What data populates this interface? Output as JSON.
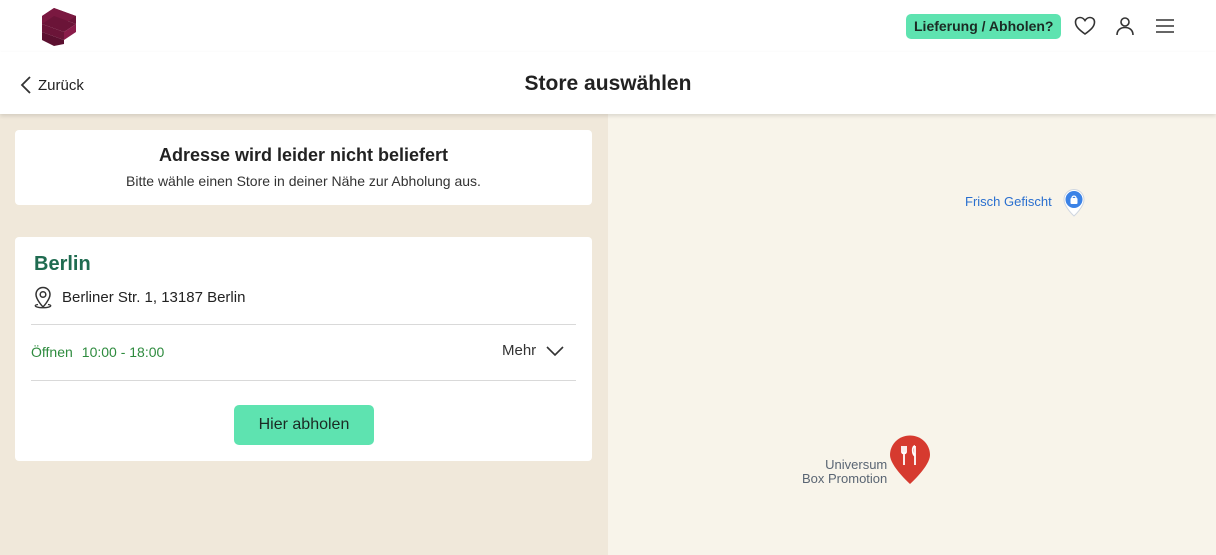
{
  "header": {
    "delivery_label": "Lieferung / Abholen?",
    "logo_icon": "brand-logo-icon",
    "icons": [
      "heart-icon",
      "user-icon",
      "menu-icon"
    ]
  },
  "subheader": {
    "back_label": "Zurück",
    "title": "Store auswählen"
  },
  "notice": {
    "title": "Adresse wird leider nicht beliefert",
    "text": "Bitte wähle einen Store in deiner Nähe zur Abholung aus."
  },
  "store": {
    "name": "Berlin",
    "address": "Berliner Str. 1, 13187 Berlin",
    "open_label": "Öffnen",
    "hours": "10:00 - 18:00",
    "more_label": "Mehr",
    "pickup_label": "Hier abholen"
  },
  "map": {
    "poi1": {
      "label": "Frisch Gefischt",
      "icon": "shopping-bag-pin-icon"
    },
    "poi2": {
      "line1": "Universum",
      "line2": "Box Promotion",
      "icon": "restaurant-pin-icon"
    }
  },
  "colors": {
    "accent": "#5ee3b0",
    "brand": "#6b1438",
    "store_name": "#1f6b50",
    "open_text": "#2e8b3e",
    "left_bg": "#f0e8da",
    "map_bg": "#f8f4ea"
  }
}
